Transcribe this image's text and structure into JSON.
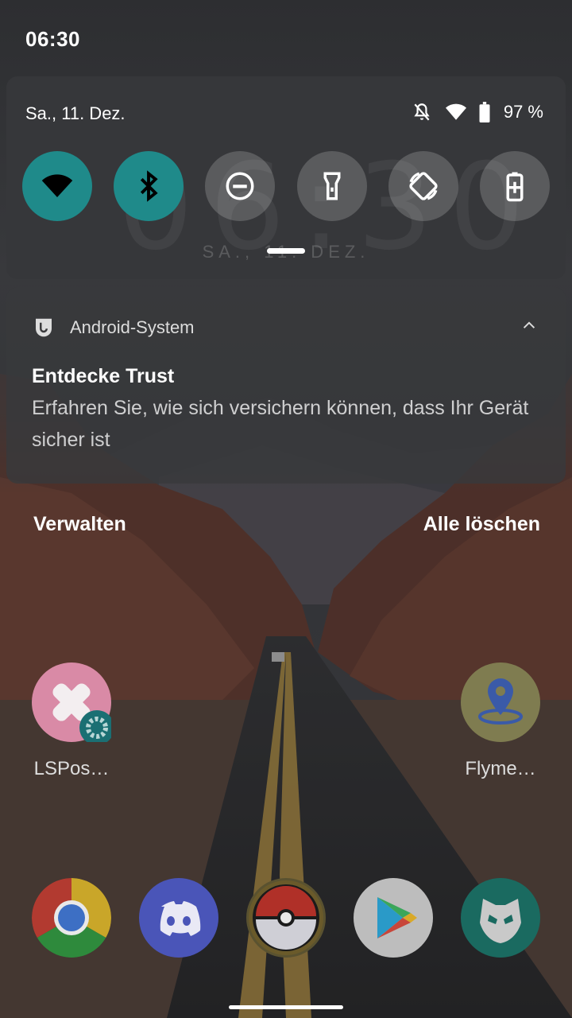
{
  "status_bar": {
    "time": "06:30"
  },
  "quick_settings": {
    "date": "Sa., 11. Dez.",
    "battery_text": "97 %",
    "ghost_clock": "06:30",
    "ghost_date": "SA., 11. DEZ.",
    "tiles": [
      {
        "name": "wifi",
        "state": "on"
      },
      {
        "name": "bluetooth",
        "state": "on"
      },
      {
        "name": "do-not-disturb",
        "state": "off"
      },
      {
        "name": "flashlight",
        "state": "off"
      },
      {
        "name": "auto-rotate",
        "state": "off"
      },
      {
        "name": "battery-saver",
        "state": "off"
      }
    ],
    "colors": {
      "tile_on": "#1f8a8a",
      "tile_off": "#5a5b5e"
    }
  },
  "notification": {
    "app_name": "Android-System",
    "title": "Entdecke Trust",
    "body": "Erfahren Sie, wie sich versichern können, dass Ihr Gerät sicher ist"
  },
  "actions": {
    "manage": "Verwalten",
    "clear_all": "Alle löschen"
  },
  "home": {
    "apps": [
      {
        "label": "LSPos…",
        "icon": "lsposed-icon"
      },
      {
        "label": "Flyme…",
        "icon": "flyme-location-icon"
      }
    ],
    "dock": [
      "chrome-icon",
      "discord-icon",
      "pokeball-icon",
      "play-store-icon",
      "alien-app-icon"
    ]
  }
}
